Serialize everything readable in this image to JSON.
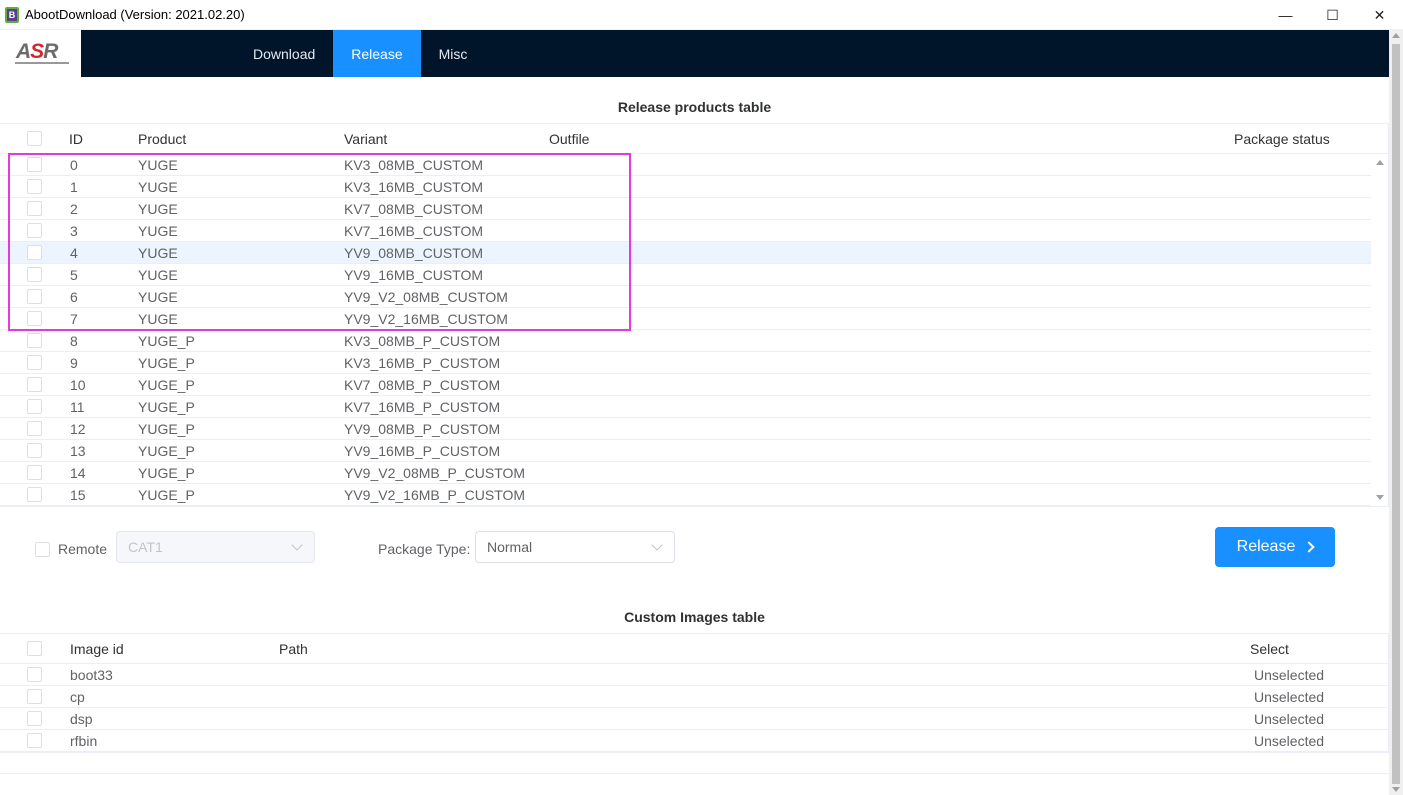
{
  "window": {
    "title": "AbootDownload (Version: 2021.02.20)",
    "minimize": "—",
    "maximize": "☐",
    "close": "✕"
  },
  "logo": {
    "text_a": "A",
    "text_s": "S",
    "text_r": "R"
  },
  "nav": {
    "items": [
      {
        "label": "Download",
        "active": false
      },
      {
        "label": "Release",
        "active": true
      },
      {
        "label": "Misc",
        "active": false
      }
    ]
  },
  "release_table": {
    "title": "Release products table",
    "columns": {
      "id": "ID",
      "product": "Product",
      "variant": "Variant",
      "outfile": "Outfile",
      "status": "Package status"
    },
    "rows": [
      {
        "id": "0",
        "product": "YUGE",
        "variant": "KV3_08MB_CUSTOM"
      },
      {
        "id": "1",
        "product": "YUGE",
        "variant": "KV3_16MB_CUSTOM"
      },
      {
        "id": "2",
        "product": "YUGE",
        "variant": "KV7_08MB_CUSTOM"
      },
      {
        "id": "3",
        "product": "YUGE",
        "variant": "KV7_16MB_CUSTOM"
      },
      {
        "id": "4",
        "product": "YUGE",
        "variant": "YV9_08MB_CUSTOM"
      },
      {
        "id": "5",
        "product": "YUGE",
        "variant": "YV9_16MB_CUSTOM"
      },
      {
        "id": "6",
        "product": "YUGE",
        "variant": "YV9_V2_08MB_CUSTOM"
      },
      {
        "id": "7",
        "product": "YUGE",
        "variant": "YV9_V2_16MB_CUSTOM"
      },
      {
        "id": "8",
        "product": "YUGE_P",
        "variant": "KV3_08MB_P_CUSTOM"
      },
      {
        "id": "9",
        "product": "YUGE_P",
        "variant": "KV3_16MB_P_CUSTOM"
      },
      {
        "id": "10",
        "product": "YUGE_P",
        "variant": "KV7_08MB_P_CUSTOM"
      },
      {
        "id": "11",
        "product": "YUGE_P",
        "variant": "KV7_16MB_P_CUSTOM"
      },
      {
        "id": "12",
        "product": "YUGE_P",
        "variant": "YV9_08MB_P_CUSTOM"
      },
      {
        "id": "13",
        "product": "YUGE_P",
        "variant": "YV9_16MB_P_CUSTOM"
      },
      {
        "id": "14",
        "product": "YUGE_P",
        "variant": "YV9_V2_08MB_P_CUSTOM"
      },
      {
        "id": "15",
        "product": "YUGE_P",
        "variant": "YV9_V2_16MB_P_CUSTOM"
      }
    ]
  },
  "controls": {
    "remote_label": "Remote",
    "remote_select_value": "CAT1",
    "package_type_label": "Package Type:",
    "package_type_value": "Normal",
    "release_button": "Release"
  },
  "images_table": {
    "title": "Custom Images table",
    "columns": {
      "image_id": "Image id",
      "path": "Path",
      "select": "Select"
    },
    "rows": [
      {
        "image_id": "boot33",
        "path": "",
        "select": "Unselected"
      },
      {
        "image_id": "cp",
        "path": "",
        "select": "Unselected"
      },
      {
        "image_id": "dsp",
        "path": "",
        "select": "Unselected"
      },
      {
        "image_id": "rfbin",
        "path": "",
        "select": "Unselected"
      }
    ]
  },
  "colors": {
    "accent": "#1890ff",
    "nav_bg": "#001529",
    "highlight_box": "#e23ae3"
  }
}
